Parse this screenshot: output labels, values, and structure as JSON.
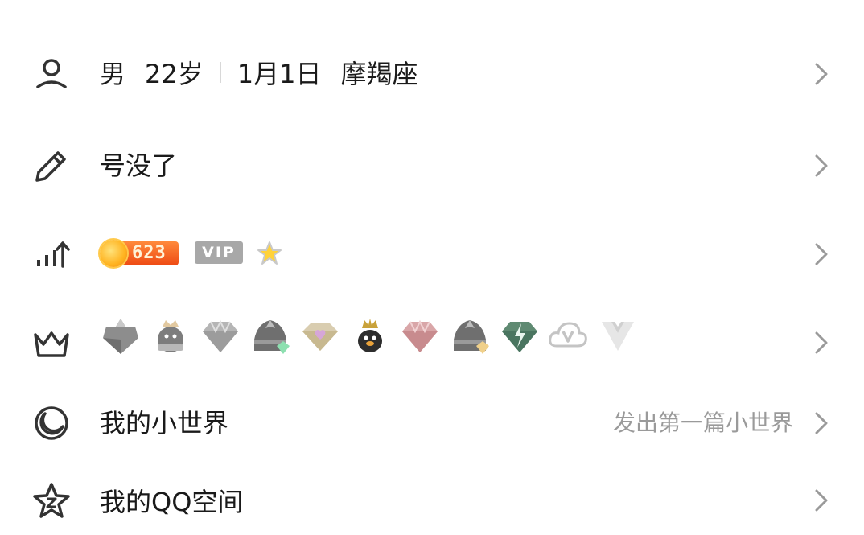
{
  "rows": {
    "profile": {
      "icon": "person-icon",
      "gender": "男",
      "age": "22岁",
      "birthday": "1月1日",
      "zodiac": "摩羯座"
    },
    "signature": {
      "icon": "pencil-icon",
      "text": "号没了"
    },
    "level": {
      "icon": "level-up-icon",
      "coin_value": "623",
      "vip_label": "VIP"
    },
    "privileges": {
      "icon": "crown-icon",
      "badges": [
        "penguin-mountain-gem-icon",
        "penguin-crown-gray-icon",
        "diamond-silver-icon",
        "penguin-mountain-green-icon",
        "heart-gem-icon",
        "penguin-gold-crown-icon",
        "diamond-pink-icon",
        "penguin-mountain-gold-icon",
        "lightning-gem-icon",
        "cloud-v-icon",
        "tuxedo-v-icon"
      ]
    },
    "small_world": {
      "icon": "moon-circle-icon",
      "label": "我的小世界",
      "hint": "发出第一篇小世界"
    },
    "qzone": {
      "icon": "star-z-icon",
      "label": "我的QQ空间"
    }
  },
  "colors": {
    "text": "#1a1a1a",
    "hint": "#9a9a9a",
    "chevron": "#9a9a9a",
    "coin_orange": "#ee4a14",
    "vip_gray": "#a8a8a8"
  }
}
